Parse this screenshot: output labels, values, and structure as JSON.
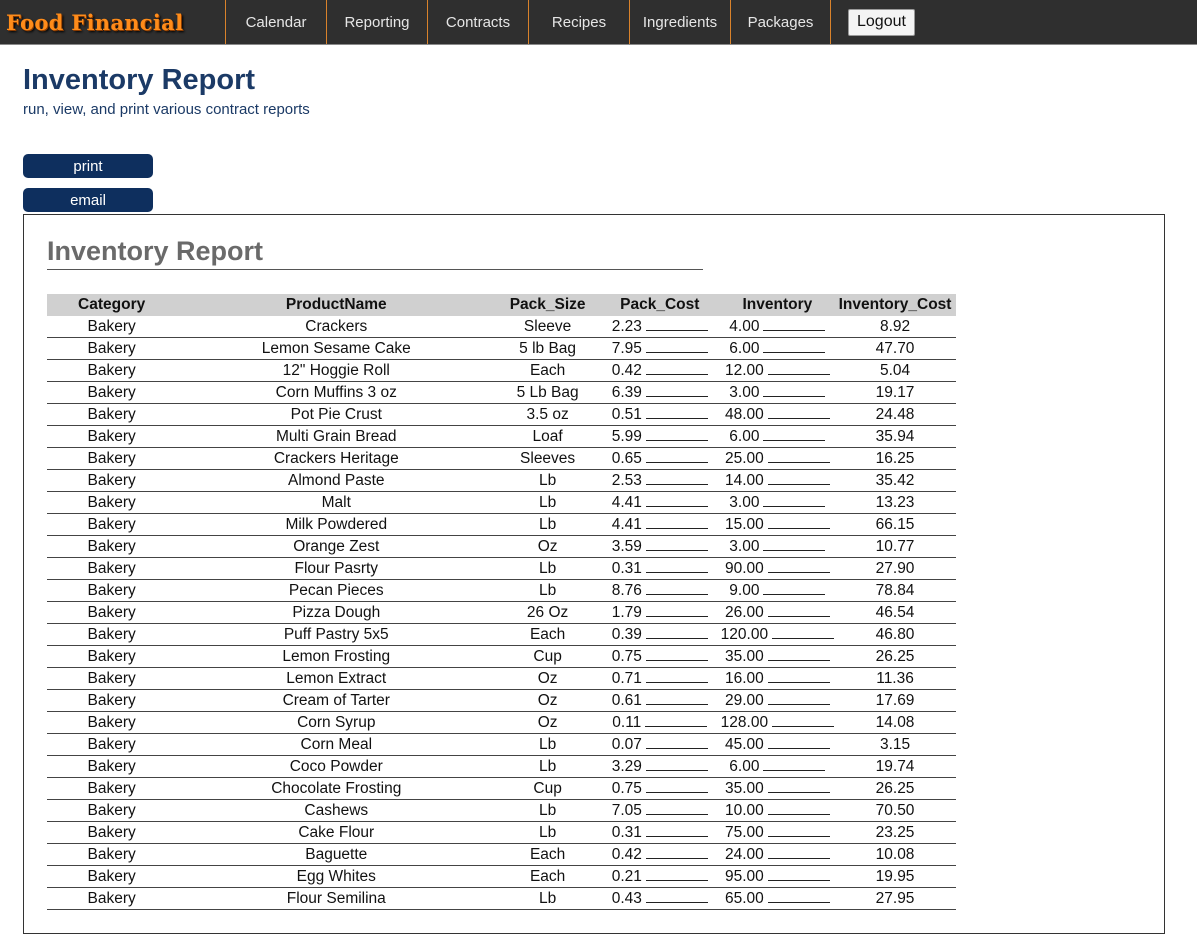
{
  "app": {
    "logo": "Food Financial"
  },
  "nav": {
    "items": [
      {
        "label": "Calendar",
        "name": "nav-calendar"
      },
      {
        "label": "Reporting",
        "name": "nav-reporting"
      },
      {
        "label": "Contracts",
        "name": "nav-contracts"
      },
      {
        "label": "Recipes",
        "name": "nav-recipes"
      },
      {
        "label": "Ingredients",
        "name": "nav-ingredients"
      },
      {
        "label": "Packages",
        "name": "nav-packages"
      }
    ],
    "logout_label": "Logout"
  },
  "page": {
    "title": "Inventory Report",
    "subtitle": "run, view, and print various contract reports"
  },
  "actions": {
    "print_label": "print",
    "email_label": "email"
  },
  "report": {
    "title": "Inventory Report",
    "columns": [
      "Category",
      "ProductName",
      "Pack_Size",
      "Pack_Cost",
      "Inventory",
      "Inventory_Cost"
    ],
    "rows": [
      [
        "Bakery",
        "Crackers",
        "Sleeve",
        "2.23",
        "4.00",
        "8.92"
      ],
      [
        "Bakery",
        "Lemon Sesame Cake",
        "5 lb Bag",
        "7.95",
        "6.00",
        "47.70"
      ],
      [
        "Bakery",
        "12\" Hoggie Roll",
        "Each",
        "0.42",
        "12.00",
        "5.04"
      ],
      [
        "Bakery",
        "Corn Muffins 3 oz",
        "5 Lb Bag",
        "6.39",
        "3.00",
        "19.17"
      ],
      [
        "Bakery",
        "Pot Pie Crust",
        "3.5 oz",
        "0.51",
        "48.00",
        "24.48"
      ],
      [
        "Bakery",
        "Multi Grain Bread",
        "Loaf",
        "5.99",
        "6.00",
        "35.94"
      ],
      [
        "Bakery",
        "Crackers Heritage",
        "Sleeves",
        "0.65",
        "25.00",
        "16.25"
      ],
      [
        "Bakery",
        "Almond Paste",
        "Lb",
        "2.53",
        "14.00",
        "35.42"
      ],
      [
        "Bakery",
        "Malt",
        "Lb",
        "4.41",
        "3.00",
        "13.23"
      ],
      [
        "Bakery",
        "Milk Powdered",
        "Lb",
        "4.41",
        "15.00",
        "66.15"
      ],
      [
        "Bakery",
        "Orange Zest",
        "Oz",
        "3.59",
        "3.00",
        "10.77"
      ],
      [
        "Bakery",
        "Flour Pasrty",
        "Lb",
        "0.31",
        "90.00",
        "27.90"
      ],
      [
        "Bakery",
        "Pecan Pieces",
        "Lb",
        "8.76",
        "9.00",
        "78.84"
      ],
      [
        "Bakery",
        "Pizza Dough",
        "26 Oz",
        "1.79",
        "26.00",
        "46.54"
      ],
      [
        "Bakery",
        "Puff Pastry 5x5",
        "Each",
        "0.39",
        "120.00",
        "46.80"
      ],
      [
        "Bakery",
        "Lemon Frosting",
        "Cup",
        "0.75",
        "35.00",
        "26.25"
      ],
      [
        "Bakery",
        "Lemon Extract",
        "Oz",
        "0.71",
        "16.00",
        "11.36"
      ],
      [
        "Bakery",
        "Cream of Tarter",
        "Oz",
        "0.61",
        "29.00",
        "17.69"
      ],
      [
        "Bakery",
        "Corn Syrup",
        "Oz",
        "0.11",
        "128.00",
        "14.08"
      ],
      [
        "Bakery",
        "Corn Meal",
        "Lb",
        "0.07",
        "45.00",
        "3.15"
      ],
      [
        "Bakery",
        "Coco Powder",
        "Lb",
        "3.29",
        "6.00",
        "19.74"
      ],
      [
        "Bakery",
        "Chocolate Frosting",
        "Cup",
        "0.75",
        "35.00",
        "26.25"
      ],
      [
        "Bakery",
        "Cashews",
        "Lb",
        "7.05",
        "10.00",
        "70.50"
      ],
      [
        "Bakery",
        "Cake Flour",
        "Lb",
        "0.31",
        "75.00",
        "23.25"
      ],
      [
        "Bakery",
        "Baguette",
        "Each",
        "0.42",
        "24.00",
        "10.08"
      ],
      [
        "Bakery",
        "Egg Whites",
        "Each",
        "0.21",
        "95.00",
        "19.95"
      ],
      [
        "Bakery",
        "Flour Semilina",
        "Lb",
        "0.43",
        "65.00",
        "27.95"
      ]
    ]
  },
  "colors": {
    "topbar": "#2f2f2f",
    "nav_divider": "#d9822b",
    "logo": "#ff8c1a",
    "title": "#1b3a66",
    "button": "#0e2f5e",
    "table_header": "#d0d0d0"
  }
}
